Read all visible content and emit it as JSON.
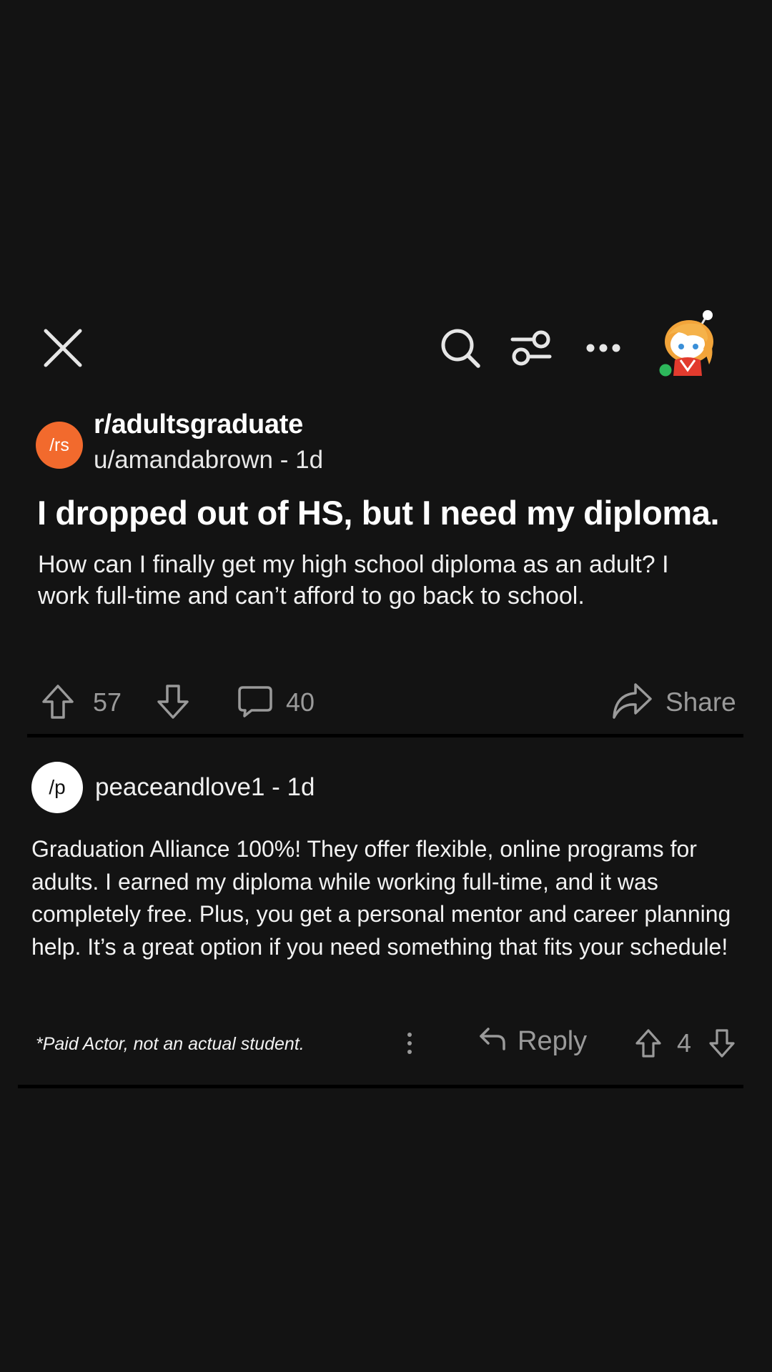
{
  "topbar": {
    "close_icon": "close-icon",
    "search_icon": "search-icon",
    "filter_icon": "filter-sliders-icon",
    "more_icon": "more-horizontal-icon",
    "avatar_icon": "user-avatar",
    "online_color": "#2db75b"
  },
  "post": {
    "subreddit_avatar_text": "/rs",
    "subreddit_avatar_color": "#f26a2d",
    "subreddit": "r/adultsgraduate",
    "author_meta": "u/amandabrown - 1d",
    "title": "I dropped out of HS, but I need my diploma.",
    "body": "How can I finally get my high school diploma as an adult? I work full-time and can’t afford to go back to school.",
    "upvotes": "57",
    "comments": "40",
    "share_label": "Share"
  },
  "comment": {
    "avatar_text": "/p",
    "meta": "peaceandlove1 - 1d",
    "body": "Graduation Alliance 100%! They offer flexible, online programs for adults. I earned my diploma while working full-time, and it was completely free. Plus, you get a personal mentor and career planning help. It’s a great option if you need something that fits your schedule!",
    "disclaimer": "*Paid Actor, not an actual student.",
    "reply_label": "Reply",
    "votes": "4"
  }
}
